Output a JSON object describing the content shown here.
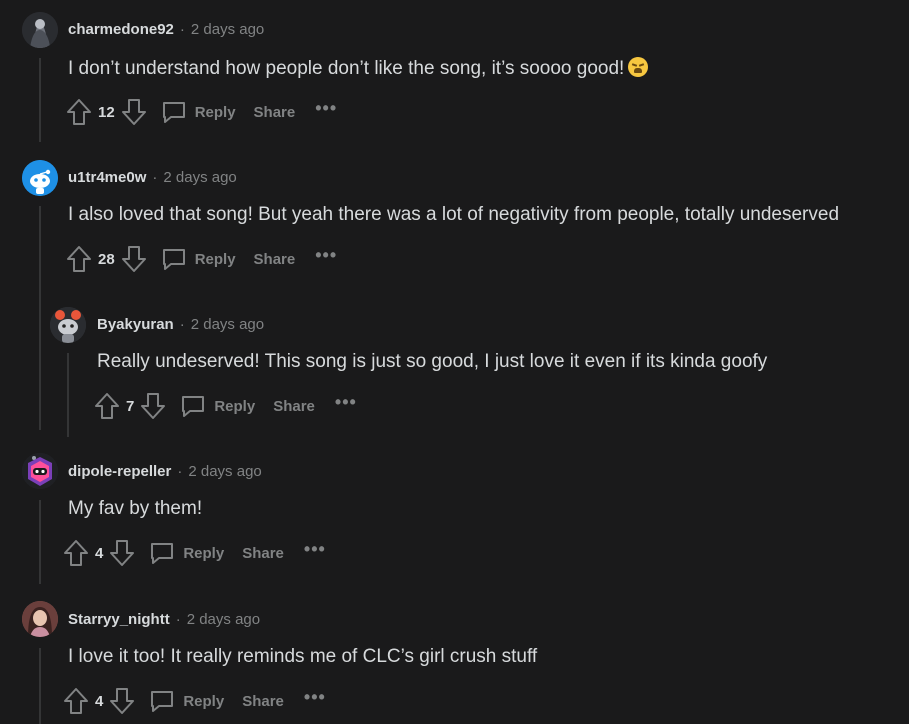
{
  "comments": [
    {
      "username": "charmedone92",
      "separator": "·",
      "time": "2 days ago",
      "text": "I don’t understand how people don’t like the song, it’s soooo good!",
      "emoji_icon": "weary-face-emoji",
      "votes": "12",
      "reply_label": "Reply",
      "share_label": "Share",
      "more_label": "•••",
      "avatar_colors": {
        "bg": "#2b2d33",
        "fg": "#9ea3ad"
      }
    },
    {
      "username": "u1tr4me0w",
      "separator": "·",
      "time": "2 days ago",
      "text": "I also loved that song! But yeah there was a lot of negativity from people, totally undeserved",
      "votes": "28",
      "reply_label": "Reply",
      "share_label": "Share",
      "more_label": "•••",
      "avatar_colors": {
        "bg": "#1e90e6",
        "fg": "#ffffff"
      }
    },
    {
      "username": "Byakyuran",
      "separator": "·",
      "time": "2 days ago",
      "text": "Really undeserved! This song is just so good, I just love it even if its kinda goofy",
      "votes": "7",
      "reply_label": "Reply",
      "share_label": "Share",
      "more_label": "•••",
      "avatar_colors": {
        "bg": "#3a3c40",
        "fg": "#e8563a"
      }
    },
    {
      "username": "dipole-repeller",
      "separator": "·",
      "time": "2 days ago",
      "text": "My fav by them!",
      "votes": "4",
      "reply_label": "Reply",
      "share_label": "Share",
      "more_label": "•••",
      "avatar_colors": {
        "bg": "#7b3fb8",
        "fg": "#ff4f9a"
      }
    },
    {
      "username": "Starryy_nightt",
      "separator": "·",
      "time": "2 days ago",
      "text": "I love it too! It really reminds me of CLC’s girl crush stuff",
      "votes": "4",
      "reply_label": "Reply",
      "share_label": "Share",
      "more_label": "•••",
      "avatar_colors": {
        "bg": "#a0605a",
        "fg": "#e8c4b0"
      }
    }
  ],
  "colors": {
    "background": "#1a1a1b",
    "text": "#d7dadc",
    "muted": "#818384",
    "thread_line": "#343536"
  }
}
